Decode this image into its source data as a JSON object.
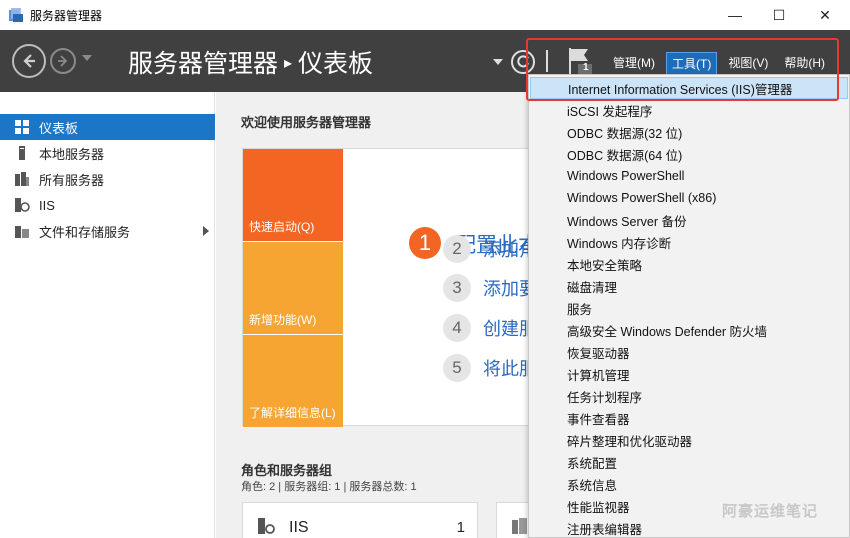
{
  "window": {
    "title": "服务器管理器",
    "min": "—",
    "max": "☐",
    "close": "✕"
  },
  "header": {
    "breadcrumb_root": "服务器管理器",
    "breadcrumb_sep": "▸",
    "breadcrumb_page": "仪表板",
    "flag_badge": "1",
    "menus": [
      {
        "label": "管理(M)"
      },
      {
        "label": "工具(T)"
      },
      {
        "label": "视图(V)"
      },
      {
        "label": "帮助(H)"
      }
    ],
    "active_menu": "工具(T)"
  },
  "sidebar": {
    "items": [
      {
        "label": "仪表板"
      },
      {
        "label": "本地服务器"
      },
      {
        "label": "所有服务器"
      },
      {
        "label": "IIS"
      },
      {
        "label": "文件和存储服务"
      }
    ]
  },
  "main": {
    "welcome_title": "欢迎使用服务器管理器",
    "tiles": [
      "快速启动(Q)",
      "新增功能(W)",
      "了解详细信息(L)"
    ],
    "step1": {
      "num": "1",
      "label": "配置此本"
    },
    "steps": [
      {
        "num": "2",
        "label": "添加角色"
      },
      {
        "num": "3",
        "label": "添加要管"
      },
      {
        "num": "4",
        "label": "创建服务"
      },
      {
        "num": "5",
        "label": "将此服务"
      }
    ],
    "roles_title": "角色和服务器组",
    "roles_sub": "角色: 2 | 服务器组: 1 | 服务器总数: 1",
    "role_card": {
      "name": "IIS",
      "count": "1"
    }
  },
  "tools_menu": {
    "items": [
      "Internet Information Services (IIS)管理器",
      "iSCSI 发起程序",
      "ODBC 数据源(32 位)",
      "ODBC 数据源(64 位)",
      "Windows PowerShell",
      "Windows PowerShell (x86)",
      "Windows Server 备份",
      "Windows 内存诊断",
      "本地安全策略",
      "磁盘清理",
      "服务",
      "高级安全 Windows Defender 防火墙",
      "恢复驱动器",
      "计算机管理",
      "任务计划程序",
      "事件查看器",
      "碎片整理和优化驱动器",
      "系统配置",
      "系统信息",
      "性能监视器",
      "注册表编辑器"
    ]
  },
  "watermark": "阿豪运维笔记",
  "colors": {
    "header_bg": "#404040",
    "accent": "#1c76c8",
    "tile_orange": "#f26522",
    "tile_amber": "#f7a532",
    "highlight_frame": "#e53935"
  }
}
